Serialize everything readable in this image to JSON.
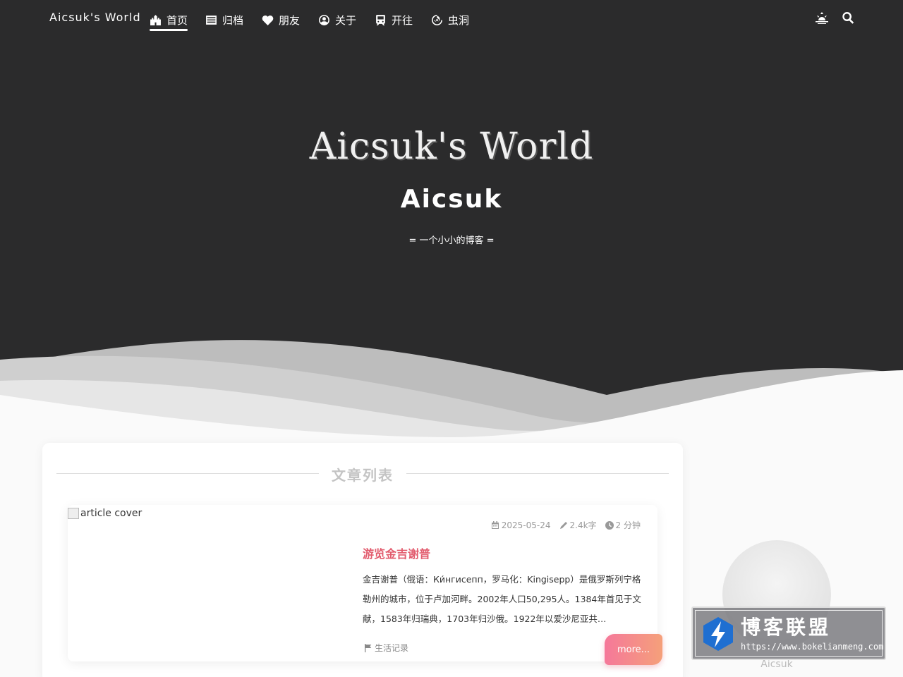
{
  "nav": {
    "brand": "Aicsuk's World",
    "items": [
      {
        "label": "首页",
        "icon": "castle-icon"
      },
      {
        "label": "归档",
        "icon": "list-icon"
      },
      {
        "label": "朋友",
        "icon": "heart-icon"
      },
      {
        "label": "关于",
        "icon": "user-circle-icon"
      },
      {
        "label": "开往",
        "icon": "train-icon"
      },
      {
        "label": "虫洞",
        "icon": "spiral-icon"
      }
    ],
    "active_index": 0,
    "right_icons": [
      "sunrise-icon",
      "search-icon"
    ]
  },
  "hero": {
    "title": "Aicsuk's World",
    "subtitle": "Aicsuk",
    "motto": "= 一个小小的博客 ="
  },
  "content": {
    "section_title": "文章列表",
    "post": {
      "cover_alt": "article cover",
      "date": "2025-05-24",
      "words": "2.4k字",
      "read_time": "2 分钟",
      "title": "游览金吉谢普",
      "excerpt": "金吉谢普（俄语：Ки́нгисепп，罗马化：Kingisepp）是俄罗斯列宁格勒州的城市，位于卢加河畔。2002年人口50,295人。1384年首见于文献，1583年归瑞典，1703年归沙俄。1922年以爱沙尼亚共…",
      "category": "生活记录",
      "more_label": "more..."
    }
  },
  "sidebar": {
    "author": "Aicsuk"
  },
  "watermark": {
    "cn": "博客联盟",
    "url": "https://www.bokelianmeng.com"
  },
  "colors": {
    "hero_bg": "#2b2b2c",
    "accent": "#e25c6e",
    "button_gradient_start": "#f5789a",
    "button_gradient_end": "#f5a07a"
  }
}
